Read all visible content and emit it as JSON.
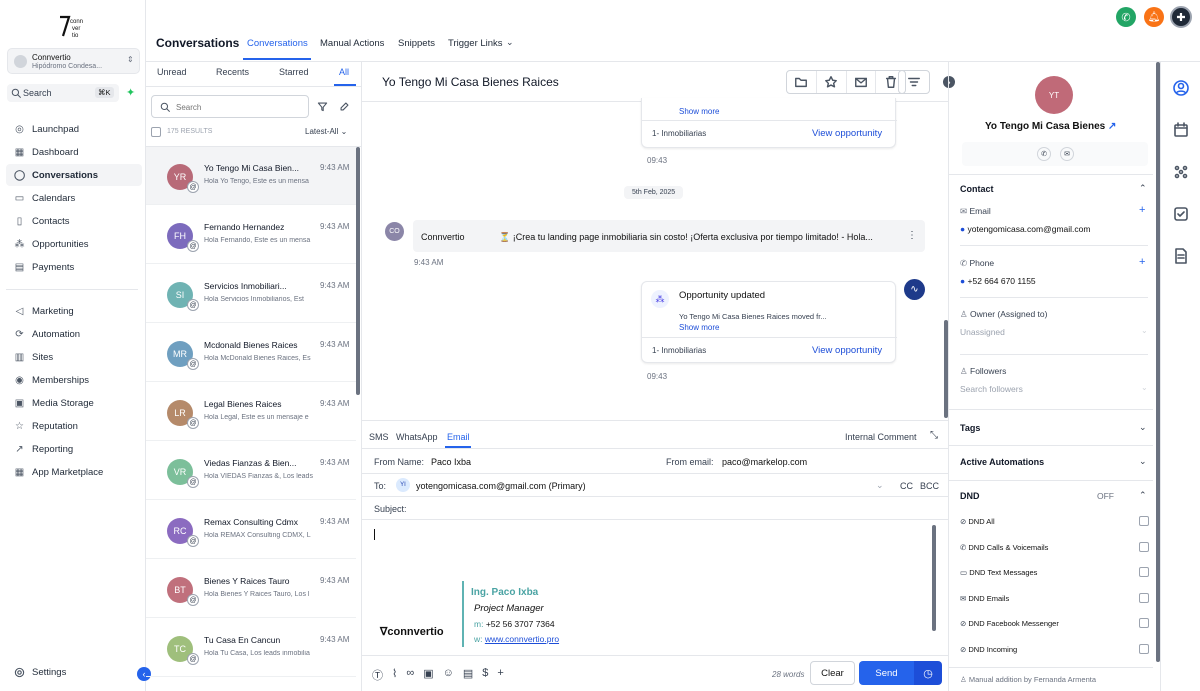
{
  "brand": {
    "logo_text": "conn\nver\ntio"
  },
  "account": {
    "name": "Connvertio",
    "location": "Hipódromo Condesa..."
  },
  "search": {
    "label": "Search",
    "shortcut": "⌘K"
  },
  "nav": {
    "group1": [
      "Launchpad",
      "Dashboard",
      "Conversations",
      "Calendars",
      "Contacts",
      "Opportunities",
      "Payments"
    ],
    "group2": [
      "Marketing",
      "Automation",
      "Sites",
      "Memberships",
      "Media Storage",
      "Reputation",
      "Reporting",
      "App Marketplace"
    ],
    "settings": "Settings"
  },
  "header": {
    "title": "Conversations",
    "tabs": [
      "Conversations",
      "Manual Actions",
      "Snippets",
      "Trigger Links"
    ]
  },
  "list": {
    "filters": [
      "Unread",
      "Recents",
      "Starred",
      "All"
    ],
    "search_placeholder": "Search",
    "results": "175 RESULTS",
    "sort": "Latest-All",
    "items": [
      {
        "initials": "YR",
        "name": "Yo Tengo Mi Casa Bien...",
        "time": "9:43 AM",
        "preview": "Hola Yo Tengo, Este es un mensa",
        "color": "#b86a78"
      },
      {
        "initials": "FH",
        "name": "Fernando Hernandez",
        "time": "9:43 AM",
        "preview": "Hola Fernando, Este es un mensa",
        "color": "#7c6bbd"
      },
      {
        "initials": "SI",
        "name": "Servicios Inmobiliari...",
        "time": "9:43 AM",
        "preview": "Hola Servicios Inmobiliarios, Est",
        "color": "#6fb3b3"
      },
      {
        "initials": "MR",
        "name": "Mcdonald Bienes Raices",
        "time": "9:43 AM",
        "preview": "Hola McDonald Bienes Raices, Es",
        "color": "#6f9fc0"
      },
      {
        "initials": "LR",
        "name": "Legal Bienes Raices",
        "time": "9:43 AM",
        "preview": "Hola Legal, Este es un mensaje e",
        "color": "#b58a6a"
      },
      {
        "initials": "VR",
        "name": "Viedas Fianzas & Bien...",
        "time": "9:43 AM",
        "preview": "Hola VIEDAS Fianzas &, Los leads",
        "color": "#7cbf9a"
      },
      {
        "initials": "RC",
        "name": "Remax Consulting Cdmx",
        "time": "9:43 AM",
        "preview": "Hola REMAX Consulting CDMX, L",
        "color": "#8b6bc0"
      },
      {
        "initials": "BT",
        "name": "Bienes Y Raices Tauro",
        "time": "9:43 AM",
        "preview": "Hola Bienes Y Raices Tauro, Los l",
        "color": "#c0707c"
      },
      {
        "initials": "TC",
        "name": "Tu Casa En Cancun",
        "time": "9:43 AM",
        "preview": "Hola Tu Casa, Los leads inmobilia",
        "color": "#9fbf7c"
      }
    ]
  },
  "chat": {
    "title": "Yo Tengo Mi Casa Bienes Raices",
    "card1": {
      "show_more": "Show more",
      "pipeline": "1- Inmobiliarias",
      "view": "View opportunity",
      "time": "09:43"
    },
    "date_sep": "5th Feb, 2025",
    "message": {
      "avatar": "CO",
      "sender": "Connvertio",
      "text": "⏳ ¡Crea tu landing page inmobiliaria sin costo! ¡Oferta exclusiva por tiempo limitado!  -  Hola...",
      "time": "9:43 AM"
    },
    "card2": {
      "title": "Opportunity updated",
      "body": "Yo Tengo Mi Casa Bienes Raices moved fr...",
      "show_more": "Show more",
      "pipeline": "1- Inmobiliarias",
      "view": "View opportunity",
      "time": "09:43"
    }
  },
  "composer": {
    "channels": [
      "SMS",
      "WhatsApp",
      "Email"
    ],
    "internal": "Internal Comment",
    "from_name_label": "From Name:",
    "from_name": "Paco Ixba",
    "from_email_label": "From email:",
    "from_email": "paco@markelop.com",
    "to_label": "To:",
    "to_badge": "YI",
    "to_value": "yotengomicasa.com@gmail.com (Primary)",
    "cc": "CC",
    "bcc": "BCC",
    "subject_label": "Subject:",
    "signature": {
      "logo": "connvertio",
      "name": "Ing. Paco Ixba",
      "role": "Project Manager",
      "m_label": "m:",
      "phone": "+52 56 3707 7364",
      "w_label": "w:",
      "web": "www.connvertio.pro"
    },
    "words": "28 words",
    "clear": "Clear",
    "send": "Send"
  },
  "contact": {
    "initials": "YT",
    "name": "Yo Tengo Mi Casa Bienes",
    "section": "Contact",
    "email_label": "Email",
    "email": "yotengomicasa.com@gmail.com",
    "phone_label": "Phone",
    "phone": "+52 664 670 1155",
    "owner_label": "Owner (Assigned to)",
    "owner": "Unassigned",
    "followers_label": "Followers",
    "followers_ph": "Search followers",
    "tags": "Tags",
    "automations": "Active Automations",
    "dnd": "DND",
    "dnd_state": "OFF",
    "dnd_items": [
      "DND All",
      "DND Calls & Voicemails",
      "DND Text Messages",
      "DND Emails",
      "DND Facebook Messenger",
      "DND Incoming"
    ],
    "footer": "Manual addition by Fernanda Armenta"
  }
}
